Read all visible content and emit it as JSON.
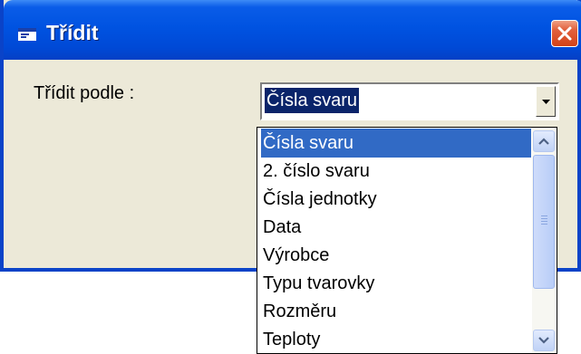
{
  "window": {
    "title": "Třídit",
    "app_icon": "window-icon",
    "close_icon": "close-icon",
    "titlebar_color": "#0053e1",
    "close_color": "#d24218"
  },
  "form": {
    "sort_label": "Třídit podle :",
    "sort_value": "Čísla svaru",
    "dropdown_icon": "chevron-down-icon"
  },
  "dropdown": {
    "selected_index": 0,
    "items": [
      "Čísla svaru",
      "2. číslo svaru",
      "Čísla jednotky",
      "Data",
      "Výrobce",
      "Typu tvarovky",
      "Rozměru",
      "Teploty"
    ],
    "scroll_up_icon": "chevron-up-icon",
    "scroll_down_icon": "chevron-down-icon",
    "highlight_color": "#316ac5"
  }
}
